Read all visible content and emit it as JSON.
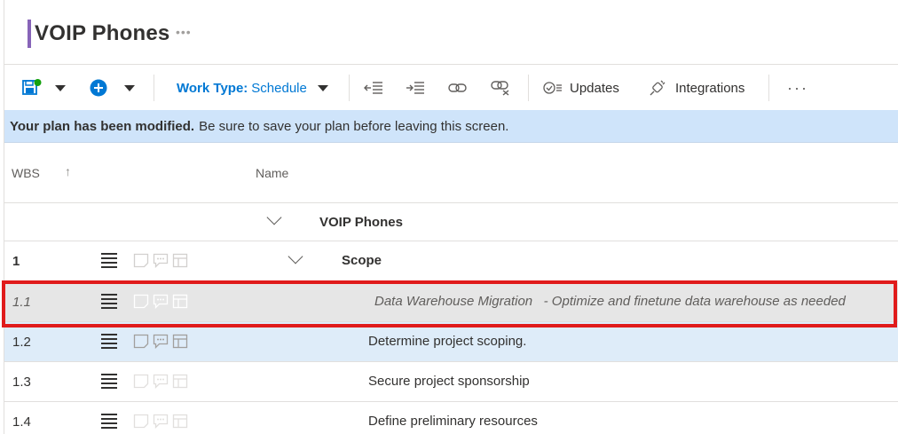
{
  "plan": {
    "title": "VOIP Phones",
    "more_glyph": "•••"
  },
  "toolbar": {
    "work_type_key": "Work Type:",
    "work_type_value": "Schedule",
    "updates_label": "Updates",
    "integrations_label": "Integrations",
    "more_glyph": "···"
  },
  "banner": {
    "bold": "Your plan has been modified.",
    "text": "Be sure to save your plan before leaving this screen."
  },
  "grid": {
    "headers": {
      "wbs": "WBS",
      "name": "Name"
    },
    "rows": [
      {
        "wbs": "",
        "name": "VOIP Phones"
      },
      {
        "wbs": "1",
        "name": "Scope"
      },
      {
        "wbs": "1.1",
        "name": "Data Warehouse Migration   - Optimize and finetune data warehouse as needed"
      },
      {
        "wbs": "1.2",
        "name": "Determine project scoping."
      },
      {
        "wbs": "1.3",
        "name": "Secure project sponsorship"
      },
      {
        "wbs": "1.4",
        "name": "Define preliminary resources"
      }
    ]
  },
  "colors": {
    "accent": "#8764b8",
    "brand": "#0078d4",
    "banner": "#cfe4fa",
    "selected_row": "#deecf9",
    "annotation": "#e01b1b"
  }
}
